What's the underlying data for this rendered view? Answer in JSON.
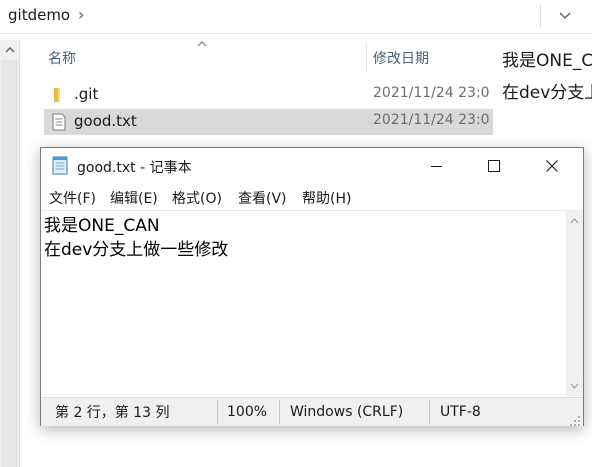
{
  "explorer": {
    "address": {
      "folder": "gitdemo",
      "separator_icon": "chevron-right-icon",
      "dropdown_icon": "chevron-down-icon"
    },
    "columns": {
      "name": "名称",
      "date": "修改日期"
    },
    "files": [
      {
        "name": ".git",
        "date": "2021/11/24 23:0",
        "icon": "folder-icon",
        "selected": false
      },
      {
        "name": "good.txt",
        "date": "2021/11/24 23:0",
        "icon": "text-file-icon",
        "selected": true
      }
    ],
    "preview": {
      "line1": "我是ONE_C",
      "line2": "在dev分支上"
    }
  },
  "notepad": {
    "title": "good.txt - 记事本",
    "menu": [
      "文件(F)",
      "编辑(E)",
      "格式(O)",
      "查看(V)",
      "帮助(H)"
    ],
    "content": {
      "line1": "我是ONE_CAN",
      "line2": "在dev分支上做一些修改"
    },
    "status": {
      "position": "第 2 行，第 13 列",
      "zoom": "100%",
      "line_ending": "Windows (CRLF)",
      "encoding": "UTF-8"
    }
  },
  "colors": {
    "selected_row": "#d9d9d9",
    "header_text": "#4c607a",
    "date_text": "#6d6d6d",
    "folder": "#f8d775"
  }
}
